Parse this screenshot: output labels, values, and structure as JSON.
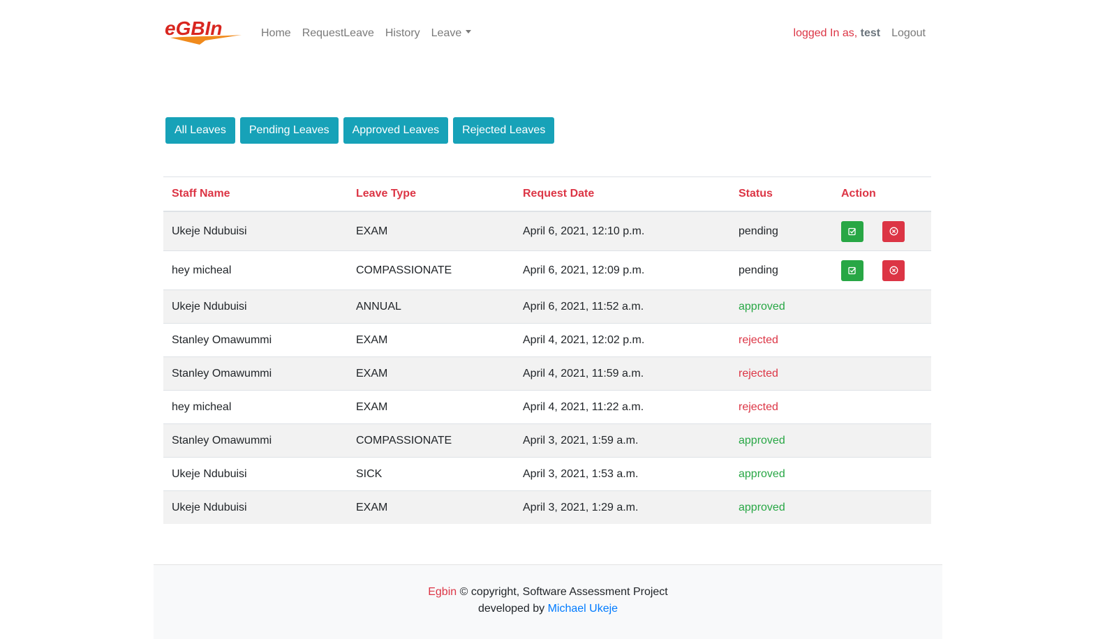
{
  "nav": {
    "logo_alt": "eGBIN",
    "links": [
      "Home",
      "RequestLeave",
      "History",
      "Leave"
    ],
    "logged_in_text": "logged In as,",
    "user": "test",
    "logout": "Logout"
  },
  "filters": [
    "All Leaves",
    "Pending Leaves",
    "Approved Leaves",
    "Rejected Leaves"
  ],
  "table": {
    "headers": [
      "Staff Name",
      "Leave Type",
      "Request Date",
      "Status",
      "Action"
    ],
    "rows": [
      {
        "name": "Ukeje Ndubuisi",
        "type": "EXAM",
        "date": "April 6, 2021, 12:10 p.m.",
        "status": "pending"
      },
      {
        "name": "hey micheal",
        "type": "COMPASSIONATE",
        "date": "April 6, 2021, 12:09 p.m.",
        "status": "pending"
      },
      {
        "name": "Ukeje Ndubuisi",
        "type": "ANNUAL",
        "date": "April 6, 2021, 11:52 a.m.",
        "status": "approved"
      },
      {
        "name": "Stanley Omawummi",
        "type": "EXAM",
        "date": "April 4, 2021, 12:02 p.m.",
        "status": "rejected"
      },
      {
        "name": "Stanley Omawummi",
        "type": "EXAM",
        "date": "April 4, 2021, 11:59 a.m.",
        "status": "rejected"
      },
      {
        "name": "hey micheal",
        "type": "EXAM",
        "date": "April 4, 2021, 11:22 a.m.",
        "status": "rejected"
      },
      {
        "name": "Stanley Omawummi",
        "type": "COMPASSIONATE",
        "date": "April 3, 2021, 1:59 a.m.",
        "status": "approved"
      },
      {
        "name": "Ukeje Ndubuisi",
        "type": "SICK",
        "date": "April 3, 2021, 1:53 a.m.",
        "status": "approved"
      },
      {
        "name": "Ukeje Ndubuisi",
        "type": "EXAM",
        "date": "April 3, 2021, 1:29 a.m.",
        "status": "approved"
      }
    ]
  },
  "footer": {
    "brand": "Egbin",
    "copyright": "© copyright, Software Assessment Project",
    "developed_by": "developed by",
    "author": "Michael Ukeje"
  },
  "colors": {
    "accent": "#17a2b8",
    "danger": "#dc3545",
    "success": "#28a745",
    "link": "#007bff",
    "logo_red": "#d8261f",
    "logo_orange": "#f08a1c"
  }
}
